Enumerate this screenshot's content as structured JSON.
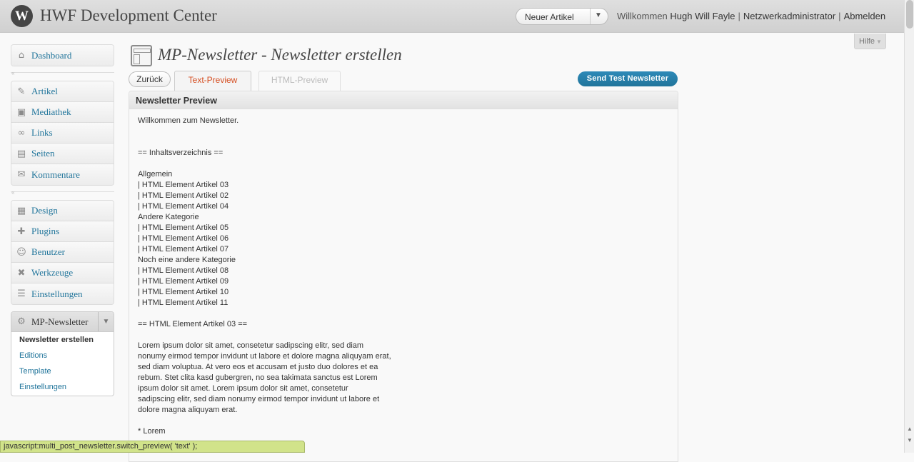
{
  "header": {
    "logo": "W",
    "site_title": "HWF Development Center",
    "favorite_action": "Neuer Artikel",
    "welcome": "Willkommen",
    "user_name": "Hugh Will Fayle",
    "network_admin": "Netzwerkadministrator",
    "logout": "Abmelden"
  },
  "help": {
    "label": "Hilfe"
  },
  "menu": {
    "group1": [
      {
        "label": "Dashboard",
        "icon": "⌂"
      }
    ],
    "group2": [
      {
        "label": "Artikel",
        "icon": "✎"
      },
      {
        "label": "Mediathek",
        "icon": "▣"
      },
      {
        "label": "Links",
        "icon": "∞"
      },
      {
        "label": "Seiten",
        "icon": "▤"
      },
      {
        "label": "Kommentare",
        "icon": "✉"
      }
    ],
    "group3": [
      {
        "label": "Design",
        "icon": "▦"
      },
      {
        "label": "Plugins",
        "icon": "✚"
      },
      {
        "label": "Benutzer",
        "icon": "☺"
      },
      {
        "label": "Werkzeuge",
        "icon": "✖"
      },
      {
        "label": "Einstellungen",
        "icon": "☰"
      }
    ],
    "mp_newsletter": {
      "label": "MP-Newsletter",
      "items": [
        "Newsletter erstellen",
        "Editions",
        "Template",
        "Einstellungen"
      ]
    }
  },
  "page": {
    "title": "MP-Newsletter - Newsletter erstellen",
    "back_button": "Zurück",
    "tab_text": "Text-Preview",
    "tab_html": "HTML-Preview",
    "send_button": "Send Test Newsletter",
    "preview_title": "Newsletter Preview",
    "preview_text": "Willkommen zum Newsletter.\n\n\n== Inhaltsverzeichnis ==\n\nAllgemein\n| HTML Element Artikel 03\n| HTML Element Artikel 02\n| HTML Element Artikel 04\nAndere Kategorie\n| HTML Element Artikel 05\n| HTML Element Artikel 06\n| HTML Element Artikel 07\nNoch eine andere Kategorie\n| HTML Element Artikel 08\n| HTML Element Artikel 09\n| HTML Element Artikel 10\n| HTML Element Artikel 11\n\n== HTML Element Artikel 03 ==\n\nLorem ipsum dolor sit amet, consetetur sadipscing elitr, sed diam\nnonumy eirmod tempor invidunt ut labore et dolore magna aliquyam erat,\nsed diam voluptua. At vero eos et accusam et justo duo dolores et ea\nrebum. Stet clita kasd gubergren, no sea takimata sanctus est Lorem\nipsum dolor sit amet. Lorem ipsum dolor sit amet, consetetur\nsadipscing elitr, sed diam nonumy eirmod tempor invidunt ut labore et\ndolore magna aliquyam erat.\n\n* Lorem"
  },
  "status_bar": {
    "text": "javascript:multi_post_newsletter.switch_preview( 'text' );"
  }
}
